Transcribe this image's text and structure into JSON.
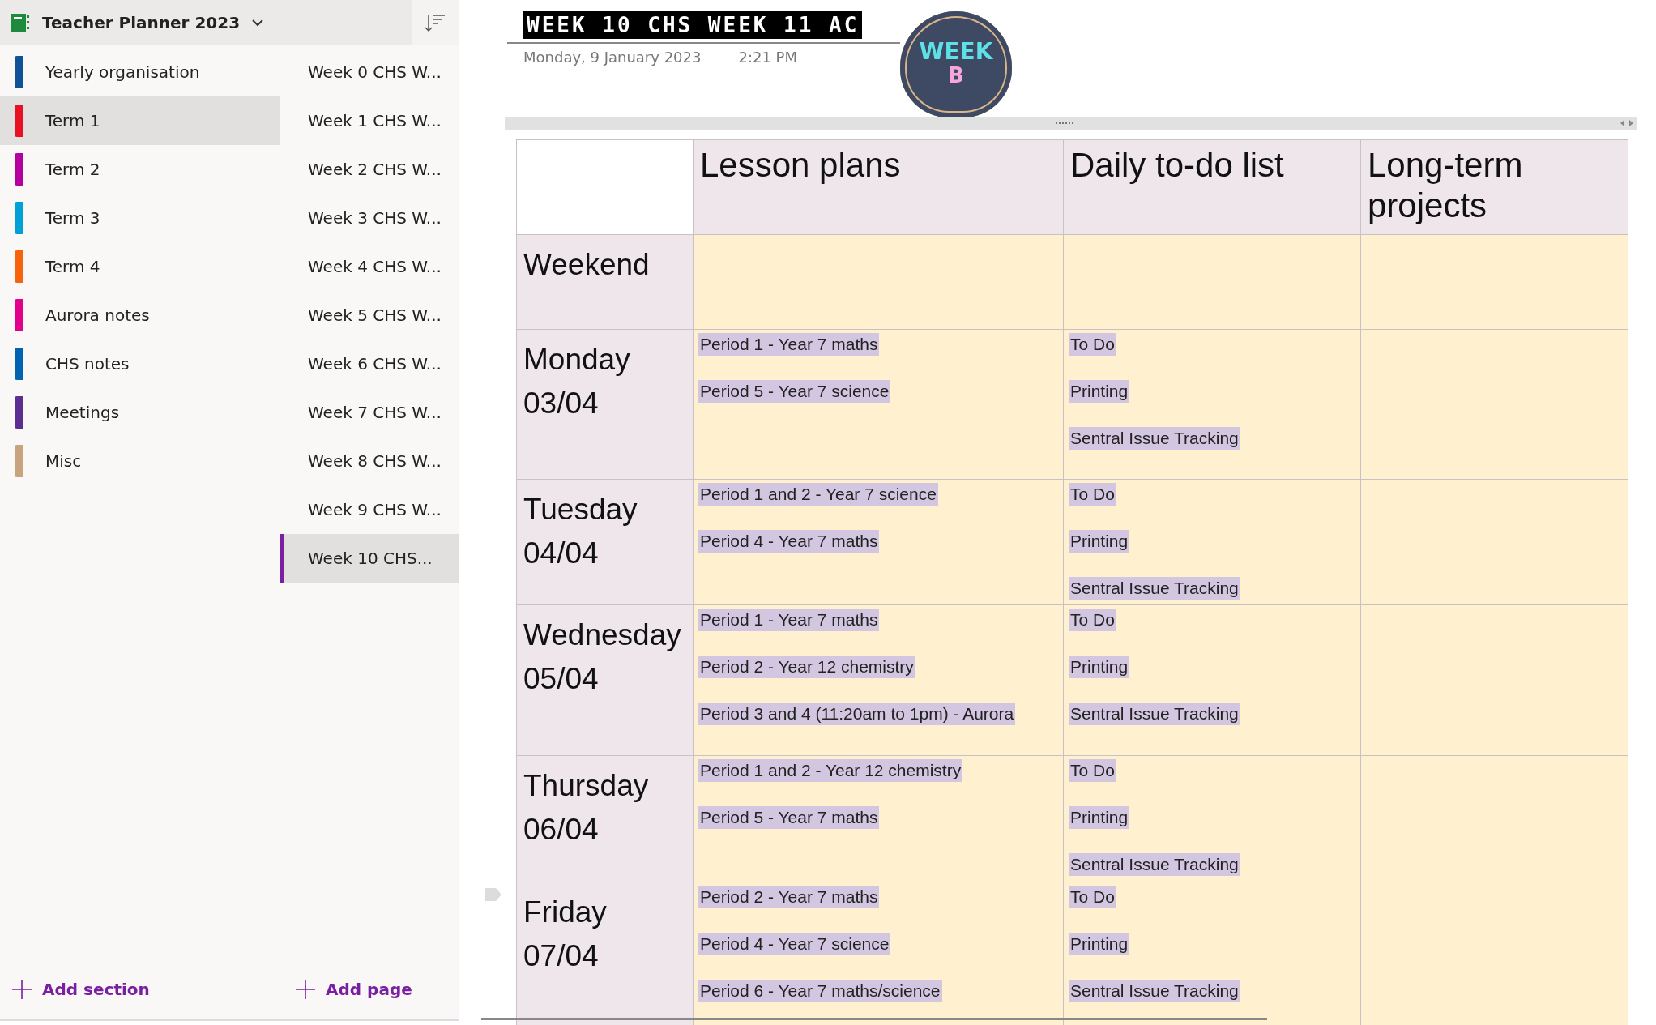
{
  "notebook": {
    "title": "Teacher Planner 2023"
  },
  "sections": [
    {
      "name": "Yearly organisation",
      "color": "#0f5297",
      "selected": false
    },
    {
      "name": "Term 1",
      "color": "#e81123",
      "selected": true
    },
    {
      "name": "Term 2",
      "color": "#b4009e",
      "selected": false
    },
    {
      "name": "Term 3",
      "color": "#00a2d6",
      "selected": false
    },
    {
      "name": "Term 4",
      "color": "#f7630c",
      "selected": false
    },
    {
      "name": "Aurora notes",
      "color": "#e3008c",
      "selected": false
    },
    {
      "name": "CHS notes",
      "color": "#0063b1",
      "selected": false
    },
    {
      "name": "Meetings",
      "color": "#5c2e91",
      "selected": false
    },
    {
      "name": "Misc",
      "color": "#c9a27e",
      "selected": false
    }
  ],
  "pages": [
    {
      "title": "Week 0 CHS W...",
      "selected": false
    },
    {
      "title": "Week 1 CHS W...",
      "selected": false
    },
    {
      "title": "Week 2 CHS W...",
      "selected": false
    },
    {
      "title": "Week 3 CHS W...",
      "selected": false
    },
    {
      "title": "Week 4 CHS W...",
      "selected": false
    },
    {
      "title": "Week 5 CHS W...",
      "selected": false
    },
    {
      "title": "Week 6 CHS W...",
      "selected": false
    },
    {
      "title": "Week 7 CHS W...",
      "selected": false
    },
    {
      "title": "Week 8 CHS W...",
      "selected": false
    },
    {
      "title": "Week 9 CHS W...",
      "selected": false
    },
    {
      "title": "Week 10 CHS...",
      "selected": true
    }
  ],
  "add_section": "Add section",
  "add_page": "Add page",
  "page": {
    "title": "WEEK 10 CHS WEEK 11 AC",
    "date": "Monday, 9 January 2023",
    "time": "2:21 PM",
    "badge": {
      "line_1": "WEEK",
      "line_2": "B"
    }
  },
  "table": {
    "columns": [
      "Lesson plans",
      "Daily to-do list",
      "Long-term projects"
    ],
    "rows": [
      {
        "day": "Weekend",
        "lessons": [],
        "todo": []
      },
      {
        "day": "Monday",
        "date": "03/04",
        "lessons": [
          "Period 1 - Year 7 maths",
          "Period 5 - Year 7 science"
        ],
        "todo": [
          "To Do",
          "Printing",
          "Sentral Issue Tracking"
        ]
      },
      {
        "day": "Tuesday",
        "date": "04/04",
        "lessons": [
          "Period 1 and 2 - Year 7 science",
          "Period 4 - Year 7 maths"
        ],
        "todo": [
          "To Do",
          "Printing",
          "Sentral Issue Tracking"
        ]
      },
      {
        "day": "Wednesday",
        "date": "05/04",
        "lessons": [
          "Period 1 - Year 7 maths",
          "Period 2 - Year 12 chemistry",
          "Period 3 and 4 (11:20am to 1pm) - Aurora"
        ],
        "todo": [
          "To Do",
          "Printing",
          "Sentral Issue Tracking"
        ]
      },
      {
        "day": "Thursday",
        "date": "06/04",
        "lessons": [
          "Period 1 and 2 - Year 12 chemistry",
          "Period 5 - Year 7 maths"
        ],
        "todo": [
          "To Do",
          "Printing",
          "Sentral Issue Tracking"
        ]
      },
      {
        "day": "Friday",
        "date": "07/04",
        "lessons": [
          "Period 2 - Year 7 maths",
          "Period 4 - Year 7 science",
          "Period 6 - Year 7 maths/science"
        ],
        "todo": [
          "To Do",
          "Printing",
          "Sentral Issue Tracking"
        ]
      }
    ]
  }
}
